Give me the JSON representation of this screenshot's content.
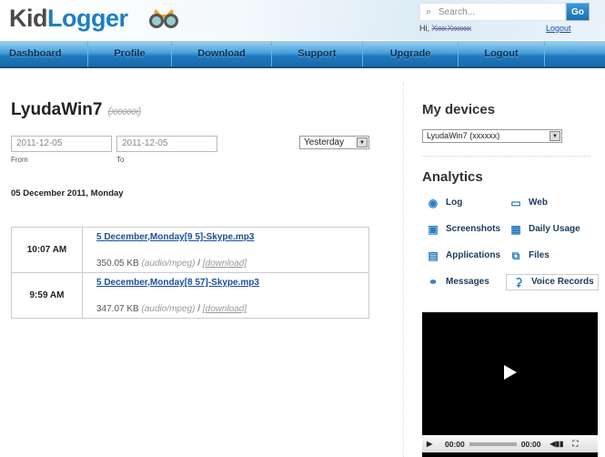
{
  "header": {
    "logo": {
      "part1": "Kid",
      "part2": "Logger"
    },
    "search_placeholder": "Search...",
    "go_label": "Go",
    "greeting": "Hi,",
    "user_name": "Xxxx Xxxxxxx",
    "logout_label": "Logout"
  },
  "nav": [
    {
      "label": "Dashboard"
    },
    {
      "label": "Profile"
    },
    {
      "label": "Download"
    },
    {
      "label": "Support"
    },
    {
      "label": "Upgrade"
    },
    {
      "label": "Logout"
    }
  ],
  "main": {
    "device_title": "LyudaWin7",
    "device_code": "(xxxxxx)",
    "from_date": "2011-12-05",
    "to_date": "2011-12-05",
    "from_label": "From",
    "to_label": "To",
    "range_select": "Yesterday",
    "day_heading": "05 December 2011, Monday",
    "records": [
      {
        "time": "10:07 AM",
        "file": "5 December,Monday[9 5]-Skype.mp3",
        "size": "350.05 KB",
        "type": "(audio/mpeg)",
        "sep": "/",
        "download": "[download]"
      },
      {
        "time": "9:59 AM",
        "file": "5 December,Monday[8 57]-Skype.mp3",
        "size": "347.07 KB",
        "type": "(audio/mpeg)",
        "sep": "/",
        "download": "[download]"
      }
    ]
  },
  "sidebar": {
    "devices_title": "My devices",
    "device_select": "LyudaWin7 (xxxxxx)",
    "analytics_title": "Analytics",
    "analytics": [
      {
        "label": "Log",
        "icon": "eye-icon"
      },
      {
        "label": "Web",
        "icon": "monitor-icon"
      },
      {
        "label": "Screenshots",
        "icon": "camera-icon"
      },
      {
        "label": "Daily Usage",
        "icon": "chart-icon"
      },
      {
        "label": "Applications",
        "icon": "window-icon"
      },
      {
        "label": "Files",
        "icon": "files-icon"
      },
      {
        "label": "Messages",
        "icon": "chat-icon"
      },
      {
        "label": "Voice Records",
        "icon": "microphone-icon",
        "active": true
      }
    ],
    "player": {
      "current_time": "00:00",
      "duration": "00:00",
      "progress": 0
    }
  }
}
